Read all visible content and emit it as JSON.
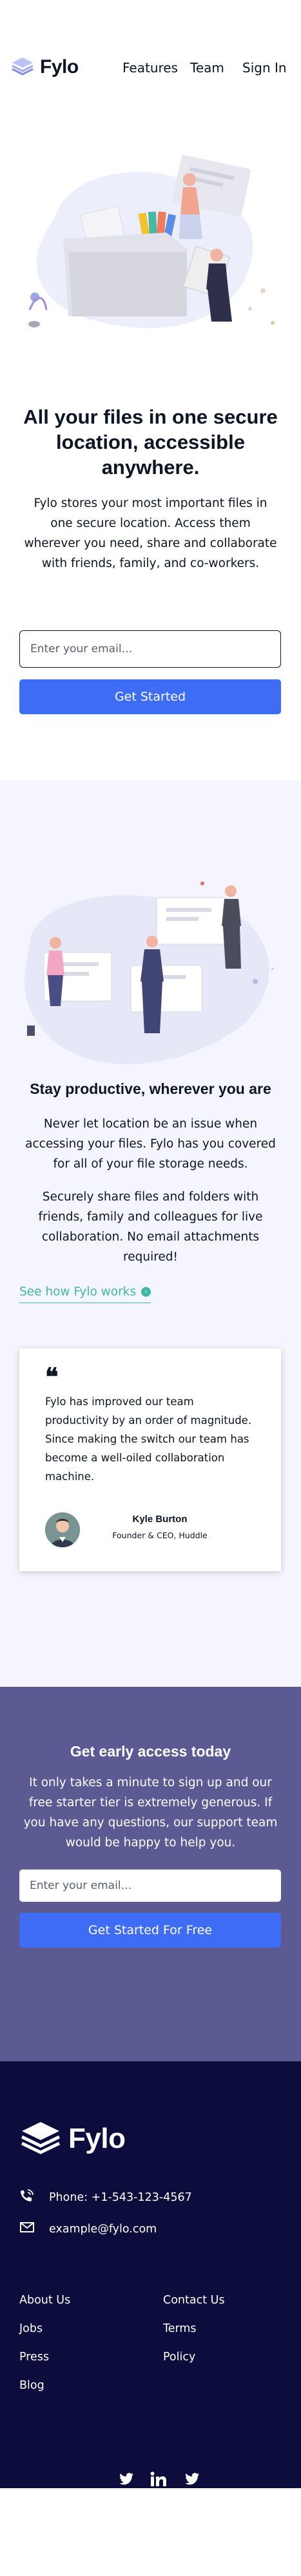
{
  "header": {
    "brand": "Fylo",
    "nav": {
      "features": "Features",
      "team": "Team",
      "signin": "Sign In"
    }
  },
  "hero": {
    "title": "All your files in one secure location, accessible anywhere.",
    "description": "Fylo stores your most important files in one secure location. Access them wherever you need, share and collaborate with friends, family, and co-workers.",
    "email_placeholder": "Enter your email…",
    "cta": "Get Started"
  },
  "productive": {
    "title": "Stay productive, wherever you are",
    "p1": "Never let location be an issue when accessing your files. Fylo has you covered for all of your file storage needs.",
    "p2": "Securely share files and folders with friends, family and colleagues for live collaboration. No email attachments required!",
    "link": "See how Fylo works"
  },
  "testimonial": {
    "quote_mark": "❝",
    "quote": "Fylo has improved our team productivity by an order of magnitude. Since making the switch our team has become a well-oiled collaboration machine.",
    "name": "Kyle Burton",
    "role": "Founder & CEO, Huddle"
  },
  "early_access": {
    "title": "Get early access today",
    "description": "It only takes a minute to sign up and our free starter tier is extremely generous. If you have any questions, our support team would be happy to help you.",
    "email_placeholder": "Enter your email…",
    "cta": "Get Started For Free"
  },
  "footer": {
    "brand": "Fylo",
    "phone": "Phone: +1-543-123-4567",
    "email": "example@fylo.com",
    "links_left": [
      "About Us",
      "Jobs",
      "Press",
      "Blog"
    ],
    "links_right": [
      "Contact Us",
      "Terms",
      "Policy"
    ],
    "social_icons": [
      "facebook-icon",
      "linkedin-icon",
      "twitter-icon"
    ]
  },
  "colors": {
    "navy": "#0c1524",
    "primary_blue": "#3f6cf5",
    "teal_link": "#3fb8a4",
    "light_bg": "#f4f5fe",
    "early_bg": "#5b5a93",
    "footer_bg": "#0c0c3d"
  }
}
